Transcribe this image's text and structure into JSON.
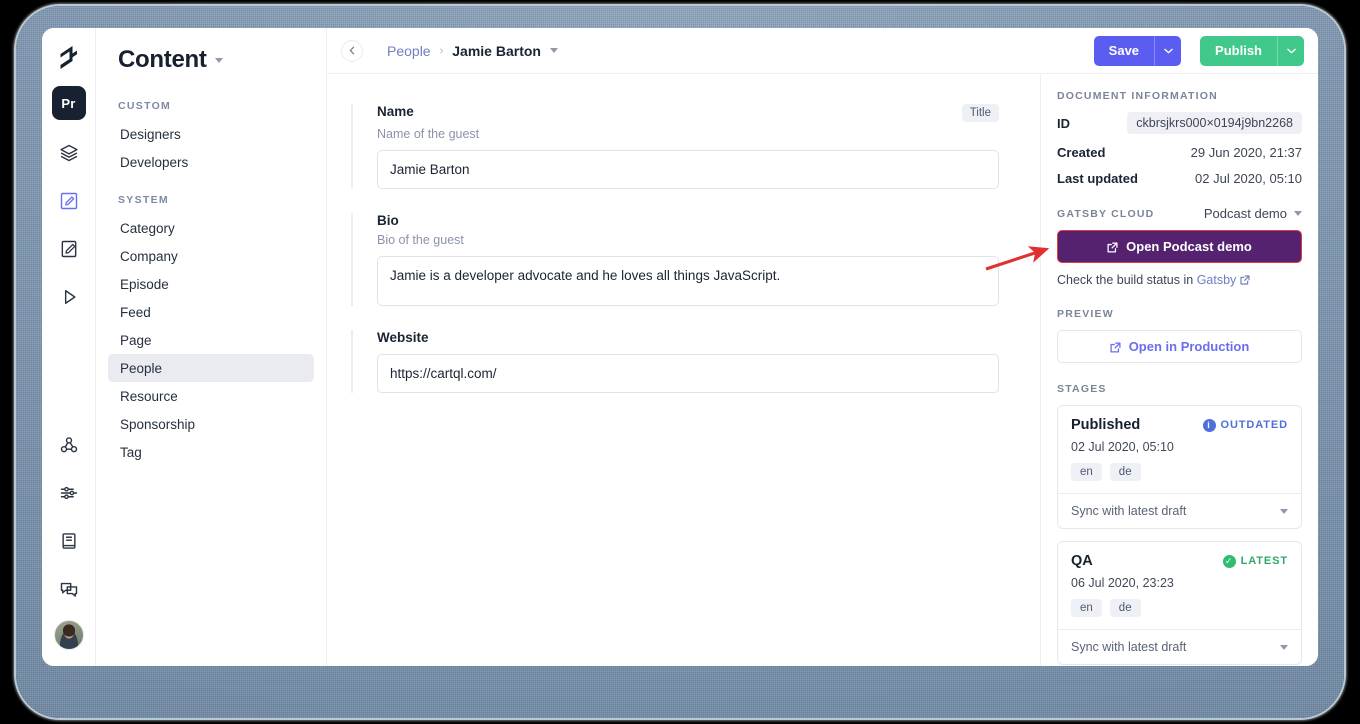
{
  "rail": {
    "project_badge": "Pr",
    "icons": [
      {
        "name": "logo-icon",
        "label": "GraphCMS logo"
      },
      {
        "name": "schema-icon",
        "label": "Schema"
      },
      {
        "name": "content-icon",
        "label": "Content"
      },
      {
        "name": "assets-icon",
        "label": "Assets"
      },
      {
        "name": "playground-icon",
        "label": "API Playground"
      },
      {
        "name": "webhooks-icon",
        "label": "Webhooks"
      },
      {
        "name": "settings-icon",
        "label": "Settings"
      },
      {
        "name": "docs-icon",
        "label": "Documentation"
      },
      {
        "name": "support-icon",
        "label": "Support"
      }
    ],
    "avatar_alt": "User avatar"
  },
  "sidebar": {
    "title": "Content",
    "groups": [
      {
        "label": "CUSTOM",
        "items": [
          {
            "label": "Designers",
            "selected": false
          },
          {
            "label": "Developers",
            "selected": false
          }
        ]
      },
      {
        "label": "SYSTEM",
        "items": [
          {
            "label": "Category",
            "selected": false
          },
          {
            "label": "Company",
            "selected": false
          },
          {
            "label": "Episode",
            "selected": false
          },
          {
            "label": "Feed",
            "selected": false
          },
          {
            "label": "Page",
            "selected": false
          },
          {
            "label": "People",
            "selected": true
          },
          {
            "label": "Resource",
            "selected": false
          },
          {
            "label": "Sponsorship",
            "selected": false
          },
          {
            "label": "Tag",
            "selected": false
          }
        ]
      }
    ]
  },
  "topbar": {
    "back_icon": "chevron-left-icon",
    "breadcrumb_parent": "People",
    "breadcrumb_separator": "›",
    "breadcrumb_current": "Jamie Barton",
    "save_label": "Save",
    "publish_label": "Publish",
    "dropdown_caret": "⌄"
  },
  "form": {
    "fields": [
      {
        "label": "Name",
        "badge": "Title",
        "hint": "Name of the guest",
        "value": "Jamie Barton",
        "placeholder": "Name of the guest",
        "tall": false
      },
      {
        "label": "Bio",
        "badge": "",
        "hint": "Bio of the guest",
        "value": "Jamie is a developer advocate and he loves all things JavaScript.",
        "placeholder": "Bio of the guest",
        "tall": true
      },
      {
        "label": "Website",
        "badge": "",
        "hint": "",
        "value": "https://cartql.com/",
        "placeholder": "Website",
        "tall": false
      }
    ]
  },
  "right_panel": {
    "document_information": {
      "heading": "DOCUMENT INFORMATION",
      "rows": [
        {
          "key": "ID",
          "value": "ckbrsjkrs000×0194j9bn2268",
          "chip": true
        },
        {
          "key": "Created",
          "value": "29 Jun 2020, 21:37",
          "chip": false
        },
        {
          "key": "Last updated",
          "value": "02 Jul 2020, 05:10",
          "chip": false
        }
      ]
    },
    "gatsby_cloud": {
      "heading": "GATSBY CLOUD",
      "selected_site": "Podcast demo",
      "button_label": "Open Podcast demo",
      "button_color": "#54226f",
      "highlight_color": "#e33b3b",
      "note_prefix": "Check the build status in",
      "note_link": "Gatsby"
    },
    "preview": {
      "heading": "PREVIEW",
      "button_label": "Open in Production"
    },
    "stages": {
      "heading": "STAGES",
      "items": [
        {
          "name": "Published",
          "status": "OUTDATED",
          "status_kind": "outdated",
          "status_color": "#4f6fdb",
          "status_icon": "info-icon",
          "date": "02 Jul 2020, 05:10",
          "languages": [
            "en",
            "de"
          ],
          "action": "Sync with latest draft"
        },
        {
          "name": "QA",
          "status": "LATEST",
          "status_kind": "latest",
          "status_color": "#2fbd6f",
          "status_icon": "check-circle-icon",
          "date": "06 Jul 2020, 23:23",
          "languages": [
            "en",
            "de"
          ],
          "action": "Sync with latest draft"
        }
      ]
    }
  },
  "annotation": {
    "arrow_color": "#e03030",
    "points_to": "Open Podcast demo"
  }
}
